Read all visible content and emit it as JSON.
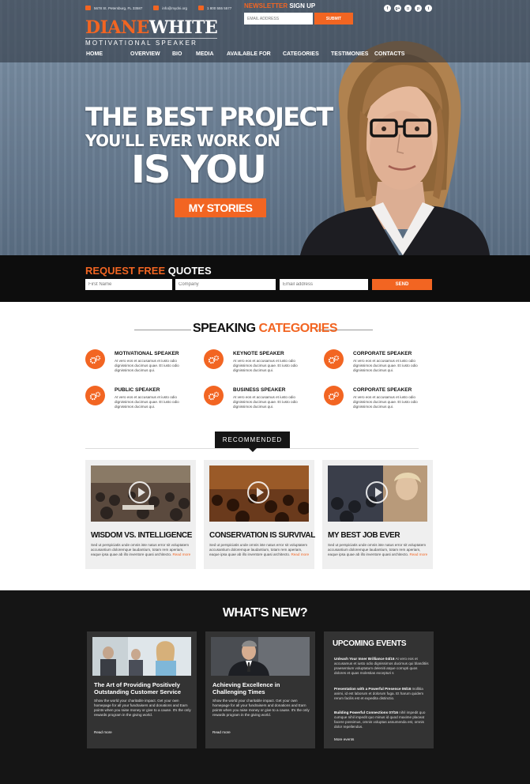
{
  "header": {
    "contact": [
      {
        "icon": "location-icon",
        "text": "5678 St. Petersburg, FL 33587"
      },
      {
        "icon": "email-icon",
        "text": "info@mydni.org"
      },
      {
        "icon": "phone-icon",
        "text": "1 800 555 5577"
      }
    ],
    "logo": {
      "first": "DIANE",
      "last": "WHITE",
      "tagline": "MOTIVATIONAL SPEAKER"
    },
    "newsletter": {
      "title_accent": "NEWSLETTER",
      "title_rest": " SIGN UP",
      "placeholder": "EMAIL ADDRESS",
      "button": "SUBMIT"
    },
    "social": [
      {
        "icon": "facebook-icon",
        "glyph": "f"
      },
      {
        "icon": "google-plus-icon",
        "glyph": "g+"
      },
      {
        "icon": "instagram-icon",
        "glyph": "◘"
      },
      {
        "icon": "pinterest-icon",
        "glyph": "p"
      },
      {
        "icon": "twitter-icon",
        "glyph": "t"
      }
    ],
    "nav": [
      "HOME",
      "OVERVIEW",
      "BIO",
      "MEDIA",
      "AVAILABLE FOR",
      "CATEGORIES",
      "TESTIMONIES",
      "CONTACTS"
    ]
  },
  "hero": {
    "line1": "THE BEST PROJECT",
    "line2": "YOU'LL EVER WORK ON",
    "line3": "IS YOU",
    "button": "MY STORIES"
  },
  "quote": {
    "title_accent": "REQUEST FREE",
    "title_rest": " QUOTES",
    "fields": [
      "First Name",
      "Company",
      "Email address"
    ],
    "button": "SEND"
  },
  "categories": {
    "title_dark": "SPEAKING ",
    "title_accent": "CATEGORIES",
    "items": [
      {
        "title": "MOTIVATIONAL SPEAKER",
        "text": "At vero eos et accusamus et iusto odio dignissimos ducimus quae. Et iusto odio dignissimos ducimus qui."
      },
      {
        "title": "KEYNOTE SPEAKER",
        "text": "At vero eos et accusamus et iusto odio dignissimos ducimus quae. Et iusto odio dignissimos ducimus qui."
      },
      {
        "title": "CORPORATE SPEAKER",
        "text": "At vero eos et accusamus et iusto odio dignissimos ducimus quae. Et iusto odio dignissimos ducimus qui."
      },
      {
        "title": "PUBLIC SPEAKER",
        "text": "At vero eos et accusamus et iusto odio dignissimos ducimus quae. Et iusto odio dignissimos ducimus qui."
      },
      {
        "title": "BUSINESS SPEAKER",
        "text": "At vero eos et accusamus et iusto odio dignissimos ducimus quae. Et iusto odio dignissimos ducimus qui."
      },
      {
        "title": "CORPORATE SPEAKER",
        "text": "At vero eos et accusamus et iusto odio dignissimos ducimus quae. Et iusto odio dignissimos ducimus qui."
      }
    ]
  },
  "recommended": {
    "tab": "RECOMMENDED",
    "cards": [
      {
        "title": "WISDOM VS. INTELLIGENCE",
        "text": "Sed ut perspiciatis unde omnis iste natus error sit voluptatem accusantium doloremque laudantium, totam rem aperiam, eaque ipsa quae ab illo inventore quasi architecto. ",
        "more": "Read more"
      },
      {
        "title": "CONSERVATION IS SURVIVAL",
        "text": "Sed ut perspiciatis unde omnis iste natus error sit voluptatem accusantium doloremque laudantium, totam rem aperiam, eaque ipsa quae ab illo inventore quasi architecto. ",
        "more": "Read more"
      },
      {
        "title": "MY BEST JOB EVER",
        "text": "Sed ut perspiciatis unde omnis iste natus error sit voluptatem accusantium doloremque laudantium, totam rem aperiam, eaque ipsa quae ab illo inventore quasi architecto. ",
        "more": "Read more"
      }
    ]
  },
  "whats_new": {
    "title": "WHAT'S NEW?",
    "posts": [
      {
        "title": "The Art of Providing Positively Outstanding Customer Service",
        "text": "Show the world your charitable impact. Get your own homepage for all your fundraisers and donations and Earn points when you raise money or give to a cause. It's the only rewards program in the giving world.",
        "more": "Read more"
      },
      {
        "title": "Achieving Excellence in Challenging Times",
        "text": "Show the world your charitable impact. Get your own homepage for all your fundraisers and donations and Earn points when you raise money or give to a cause. It's the only rewards program in the giving world.",
        "more": "Read more"
      }
    ],
    "events": {
      "title": "UPCOMING EVENTS",
      "items": [
        {
          "title": "Unleash Your Inner Brilliance 04/16",
          "text": " At vero eos et accusamus et iusto odio dignissimos ducimus qui blanditiis praesentium voluptatum deleniti atque corrupti quos dolores et quas molestias excepturi s"
        },
        {
          "title": "Presentation with a Powerful Presence 06/16",
          "text": " mollitia animi, id est laborum et dolorum fuga. Et harum quidem rerum facilis est et expedita distinctio."
        },
        {
          "title": "Building Powerful Connections 07/16",
          "text": " nihil impedit quo cumque nihil impedit quo minus id quod maxime placeat facere possimus, omnis voluptas assumenda est, omnis dolor repellendus."
        }
      ],
      "more": "More events"
    }
  },
  "colors": {
    "accent": "#f26522",
    "dark": "#151515",
    "card": "#efefef",
    "news_card": "#333333"
  }
}
